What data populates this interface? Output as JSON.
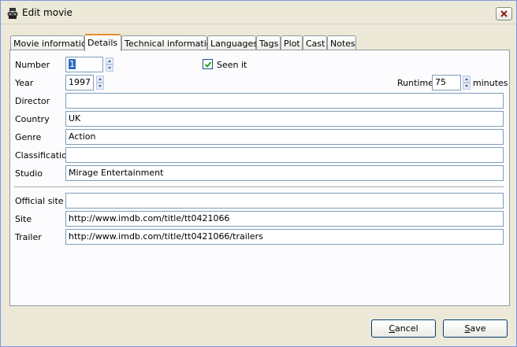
{
  "window": {
    "title": "Edit movie"
  },
  "tabs": [
    {
      "label": "Movie information"
    },
    {
      "label": "Details"
    },
    {
      "label": "Technical information"
    },
    {
      "label": "Languages"
    },
    {
      "label": "Tags"
    },
    {
      "label": "Plot"
    },
    {
      "label": "Cast"
    },
    {
      "label": "Notes"
    }
  ],
  "details": {
    "number_label": "Number",
    "number_value": "1",
    "seen_label": "Seen it",
    "seen_checked": true,
    "year_label": "Year",
    "year_value": "1997",
    "runtime_label": "Runtime",
    "runtime_value": "75",
    "runtime_unit": "minutes",
    "director_label": "Director",
    "director_value": "",
    "country_label": "Country",
    "country_value": "UK",
    "genre_label": "Genre",
    "genre_value": "Action",
    "classification_label": "Classification",
    "classification_value": "",
    "studio_label": "Studio",
    "studio_value": "Mirage Entertainment",
    "official_site_label": "Official site",
    "official_site_value": "",
    "site_label": "Site",
    "site_value": "http://www.imdb.com/title/tt0421066",
    "trailer_label": "Trailer",
    "trailer_value": "http://www.imdb.com/title/tt0421066/trailers"
  },
  "buttons": {
    "cancel_accel": "C",
    "cancel_rest": "ancel",
    "save_accel": "S",
    "save_rest": "ave"
  },
  "icons": {
    "app": "movie-reel-icon",
    "close": "close-icon",
    "check": "checkmark-icon"
  }
}
